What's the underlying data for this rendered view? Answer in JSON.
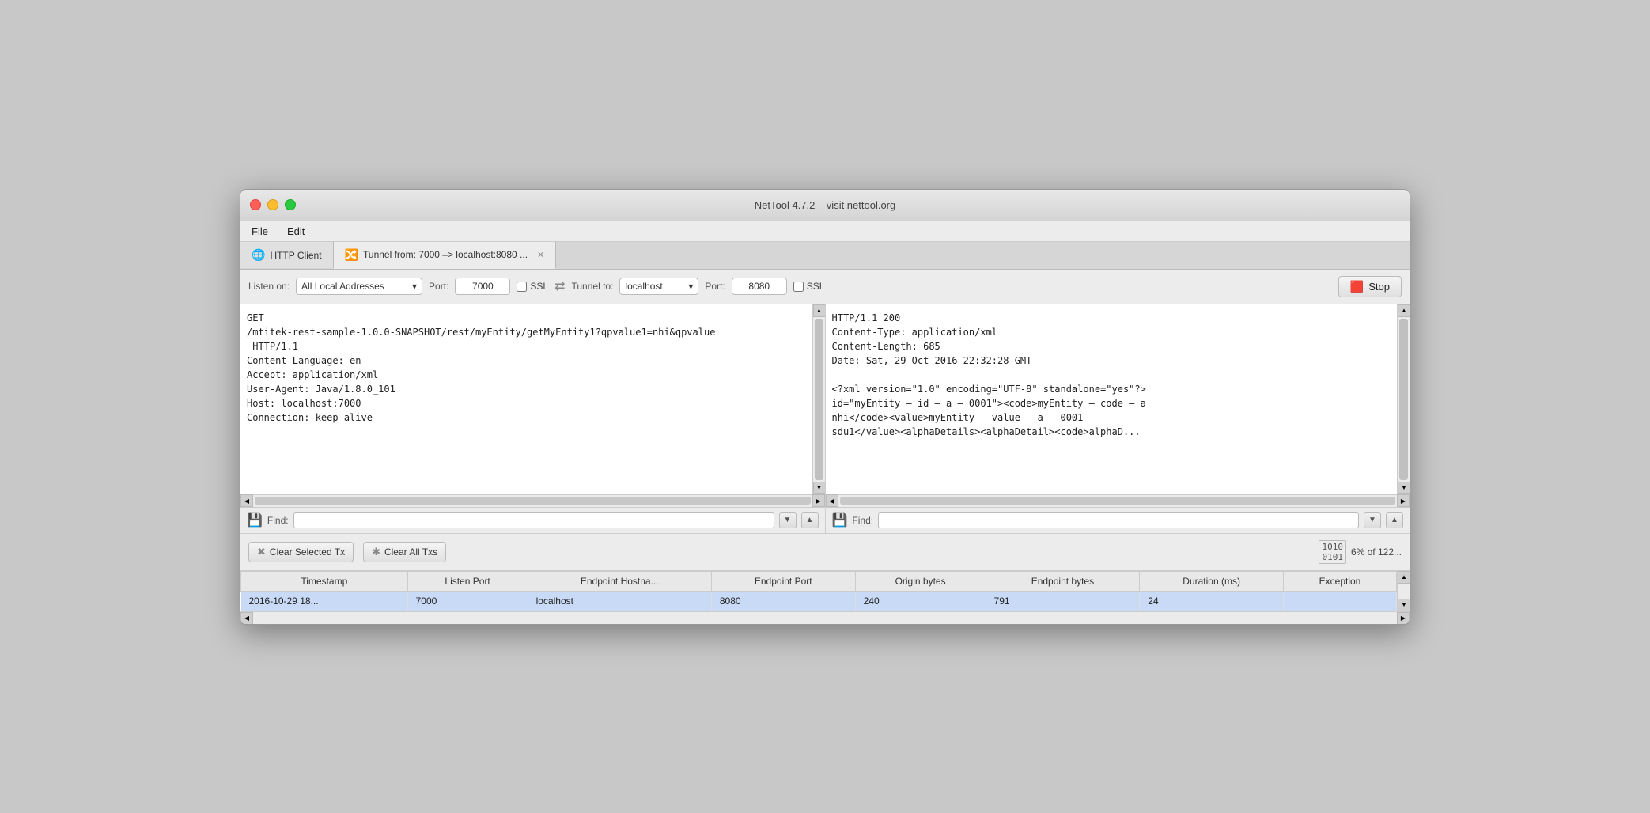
{
  "window": {
    "title": "NetTool 4.7.2 – visit nettool.org"
  },
  "menu": {
    "file": "File",
    "edit": "Edit"
  },
  "tabs": [
    {
      "id": "http-client",
      "icon": "🌐",
      "label": "HTTP Client",
      "active": false
    },
    {
      "id": "tunnel",
      "icon": "🔀",
      "label": "Tunnel from:  7000 –> localhost:8080 ...",
      "active": true
    }
  ],
  "toolbar": {
    "listen_label": "Listen on:",
    "listen_value": "All Local Addresses",
    "port_label": "Port:",
    "listen_port": "7000",
    "ssl_label": "SSL",
    "tunnel_label": "Tunnel to:",
    "tunnel_host": "localhost",
    "tunnel_port": "8080",
    "ssl2_label": "SSL",
    "stop_label": "Stop"
  },
  "left_pane": {
    "content": "GET\n/mtitek-rest-sample-1.0.0-SNAPSHOT/rest/myEntity/getMyEntity1?qpvalue1=nhi&qpvalue\n HTTP/1.1\nContent-Language: en\nAccept: application/xml\nUser-Agent: Java/1.8.0_101\nHost: localhost:7000\nConnection: keep-alive"
  },
  "right_pane": {
    "content": "HTTP/1.1 200\nContent-Type: application/xml\nContent-Length: 685\nDate: Sat, 29 Oct 2016 22:32:28 GMT\n\n<?xml version=\"1.0\" encoding=\"UTF-8\" standalone=\"yes\"?>\nid=\"myEntity – id – a – 0001\"><code>myEntity – code – a\nnhi</code><value>myEntity – value – a – 0001 –\nsdu1</value><alphaDetails><alphaDetail><code>alphaD..."
  },
  "find_bars": {
    "label": "Find:",
    "left_value": "",
    "right_value": ""
  },
  "transaction_bar": {
    "clear_selected_label": "Clear Selected Tx",
    "clear_all_label": "Clear All Txs",
    "storage_text": "6% of 122..."
  },
  "table": {
    "columns": [
      "Timestamp",
      "Listen Port",
      "Endpoint Hostna...",
      "Endpoint Port",
      "Origin bytes",
      "Endpoint bytes",
      "Duration (ms)",
      "Exception"
    ],
    "rows": [
      {
        "timestamp": "2016-10-29 18...",
        "listen_port": "7000",
        "endpoint_host": "localhost",
        "endpoint_port": "8080",
        "origin_bytes": "240",
        "endpoint_bytes": "791",
        "duration": "24",
        "exception": "",
        "selected": true
      }
    ]
  }
}
